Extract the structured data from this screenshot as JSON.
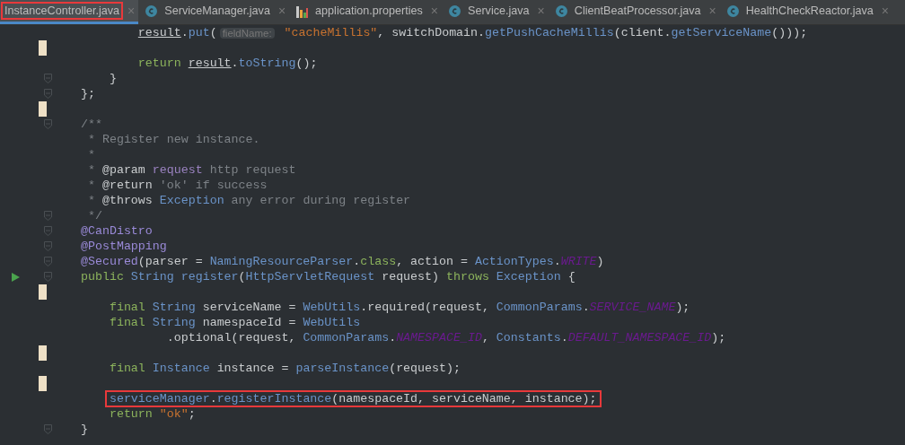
{
  "tabs": [
    {
      "label": "InstanceController.java",
      "kind": "plain",
      "selected": true,
      "highlighted": true,
      "close": "×"
    },
    {
      "label": "ServiceManager.java",
      "kind": "class",
      "selected": false,
      "highlighted": false,
      "close": "×"
    },
    {
      "label": "application.properties",
      "kind": "properties",
      "selected": false,
      "highlighted": false,
      "close": "×"
    },
    {
      "label": "Service.java",
      "kind": "class",
      "selected": false,
      "highlighted": false,
      "close": "×"
    },
    {
      "label": "ClientBeatProcessor.java",
      "kind": "class",
      "selected": false,
      "highlighted": false,
      "close": "×"
    },
    {
      "label": "HealthCheckReactor.java",
      "kind": "class",
      "selected": false,
      "highlighted": false,
      "close": "×"
    }
  ],
  "code_lines": [
    {
      "kind": "code",
      "tokens": [
        {
          "t": "        result",
          "kind": "var"
        },
        {
          "t": ".",
          "kind": "plain"
        },
        {
          "t": "put",
          "kind": "call"
        },
        {
          "t": "(",
          "kind": "plain"
        },
        {
          "t": "fieldName:",
          "kind": "hint"
        },
        {
          "t": " \"cacheMillis\"",
          "kind": "str"
        },
        {
          "t": ", switchDomain.",
          "kind": "plain"
        },
        {
          "t": "getPushCacheMillis",
          "kind": "call"
        },
        {
          "t": "(client.",
          "kind": "plain"
        },
        {
          "t": "getServiceName",
          "kind": "call"
        },
        {
          "t": "()));",
          "kind": "plain"
        }
      ]
    },
    {
      "kind": "bookmark"
    },
    {
      "kind": "code",
      "tokens": [
        {
          "t": "        return ",
          "kind": "kw"
        },
        {
          "t": "result",
          "kind": "var"
        },
        {
          "t": ".",
          "kind": "plain"
        },
        {
          "t": "toString",
          "kind": "call"
        },
        {
          "t": "();",
          "kind": "plain"
        }
      ]
    },
    {
      "kind": "code",
      "tokens": [
        {
          "t": "    }",
          "kind": "plain"
        }
      ],
      "fold": true
    },
    {
      "kind": "code",
      "tokens": [
        {
          "t": "};",
          "kind": "plain"
        }
      ],
      "fold": true
    },
    {
      "kind": "bookmark"
    },
    {
      "kind": "code",
      "tokens": [
        {
          "t": "/**",
          "kind": "comment"
        }
      ],
      "fold": true
    },
    {
      "kind": "code",
      "tokens": [
        {
          "t": " * Register new instance.",
          "kind": "comment"
        }
      ]
    },
    {
      "kind": "code",
      "tokens": [
        {
          "t": " *",
          "kind": "comment"
        }
      ]
    },
    {
      "kind": "code",
      "tokens": [
        {
          "t": " * ",
          "kind": "comment"
        },
        {
          "t": "@param ",
          "kind": "tag"
        },
        {
          "t": "request",
          "kind": "docref"
        },
        {
          "t": " http request",
          "kind": "comment"
        }
      ]
    },
    {
      "kind": "code",
      "tokens": [
        {
          "t": " * ",
          "kind": "comment"
        },
        {
          "t": "@return",
          "kind": "tag"
        },
        {
          "t": " 'ok' if success",
          "kind": "comment"
        }
      ]
    },
    {
      "kind": "code",
      "tokens": [
        {
          "t": " * ",
          "kind": "comment"
        },
        {
          "t": "@throws ",
          "kind": "tag"
        },
        {
          "t": "Exception",
          "kind": "type"
        },
        {
          "t": " any error during register",
          "kind": "comment"
        }
      ]
    },
    {
      "kind": "code",
      "tokens": [
        {
          "t": " */",
          "kind": "comment"
        }
      ],
      "fold": true
    },
    {
      "kind": "code",
      "tokens": [
        {
          "t": "@CanDistro",
          "kind": "annot"
        }
      ],
      "fold": true
    },
    {
      "kind": "code",
      "tokens": [
        {
          "t": "@PostMapping",
          "kind": "annot"
        }
      ],
      "fold": true
    },
    {
      "kind": "code",
      "tokens": [
        {
          "t": "@Secured",
          "kind": "annot"
        },
        {
          "t": "(parser = ",
          "kind": "plain"
        },
        {
          "t": "NamingResourceParser",
          "kind": "type"
        },
        {
          "t": ".",
          "kind": "plain"
        },
        {
          "t": "class",
          "kind": "kw"
        },
        {
          "t": ", action = ",
          "kind": "plain"
        },
        {
          "t": "ActionTypes",
          "kind": "type"
        },
        {
          "t": ".",
          "kind": "plain"
        },
        {
          "t": "WRITE",
          "kind": "const"
        },
        {
          "t": ")",
          "kind": "plain"
        }
      ],
      "fold": true
    },
    {
      "kind": "run",
      "tokens": [
        {
          "t": "public ",
          "kind": "kw"
        },
        {
          "t": "String ",
          "kind": "type"
        },
        {
          "t": "register",
          "kind": "call"
        },
        {
          "t": "(",
          "kind": "plain"
        },
        {
          "t": "HttpServletRequest",
          "kind": "type"
        },
        {
          "t": " request) ",
          "kind": "plain"
        },
        {
          "t": "throws ",
          "kind": "kw"
        },
        {
          "t": "Exception",
          "kind": "type"
        },
        {
          "t": " {",
          "kind": "plain"
        }
      ],
      "fold": true
    },
    {
      "kind": "bookmark"
    },
    {
      "kind": "code",
      "tokens": [
        {
          "t": "    final ",
          "kind": "kw"
        },
        {
          "t": "String",
          "kind": "type"
        },
        {
          "t": " serviceName = ",
          "kind": "plain"
        },
        {
          "t": "WebUtils",
          "kind": "type"
        },
        {
          "t": ".required(request, ",
          "kind": "plain"
        },
        {
          "t": "CommonParams",
          "kind": "type"
        },
        {
          "t": ".",
          "kind": "plain"
        },
        {
          "t": "SERVICE_NAME",
          "kind": "const"
        },
        {
          "t": ");",
          "kind": "plain"
        }
      ]
    },
    {
      "kind": "code",
      "tokens": [
        {
          "t": "    final ",
          "kind": "kw"
        },
        {
          "t": "String",
          "kind": "type"
        },
        {
          "t": " namespaceId = ",
          "kind": "plain"
        },
        {
          "t": "WebUtils",
          "kind": "type"
        }
      ]
    },
    {
      "kind": "code",
      "tokens": [
        {
          "t": "            .optional(request, ",
          "kind": "plain"
        },
        {
          "t": "CommonParams",
          "kind": "type"
        },
        {
          "t": ".",
          "kind": "plain"
        },
        {
          "t": "NAMESPACE_ID",
          "kind": "const"
        },
        {
          "t": ", ",
          "kind": "plain"
        },
        {
          "t": "Constants",
          "kind": "type"
        },
        {
          "t": ".",
          "kind": "plain"
        },
        {
          "t": "DEFAULT_NAMESPACE_ID",
          "kind": "const"
        },
        {
          "t": ");",
          "kind": "plain"
        }
      ]
    },
    {
      "kind": "bookmark"
    },
    {
      "kind": "code",
      "tokens": [
        {
          "t": "    final ",
          "kind": "kw"
        },
        {
          "t": "Instance",
          "kind": "type"
        },
        {
          "t": " instance = ",
          "kind": "plain"
        },
        {
          "t": "parseInstance",
          "kind": "call"
        },
        {
          "t": "(request);",
          "kind": "plain"
        }
      ]
    },
    {
      "kind": "bookmark"
    },
    {
      "kind": "code",
      "tokens": [
        {
          "t": "    serviceManager",
          "kind": "type"
        },
        {
          "t": ".",
          "kind": "plain"
        },
        {
          "t": "registerInstance",
          "kind": "call"
        },
        {
          "t": "(namespaceId, serviceName, instance);",
          "kind": "plain"
        }
      ],
      "highlighted": true
    },
    {
      "kind": "code",
      "tokens": [
        {
          "t": "    return ",
          "kind": "kw"
        },
        {
          "t": "\"ok\"",
          "kind": "str"
        },
        {
          "t": ";",
          "kind": "plain"
        }
      ]
    },
    {
      "kind": "code",
      "tokens": [
        {
          "t": "}",
          "kind": "plain"
        }
      ],
      "fold": true
    }
  ]
}
